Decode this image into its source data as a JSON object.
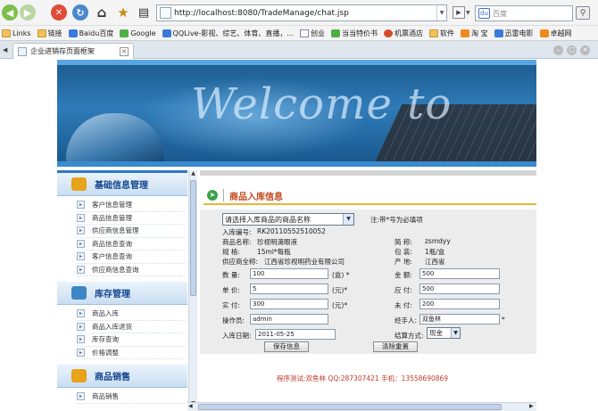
{
  "browser": {
    "address": "http://localhost:8080/TradeManage/chat.jsp",
    "search_placeholder": "百度",
    "search_engine_glyph": "du",
    "bookmarks": [
      {
        "label": "Links",
        "icon": "folder"
      },
      {
        "label": "链接",
        "icon": "folder"
      },
      {
        "label": "Baidu百度",
        "icon": "blue"
      },
      {
        "label": "Google",
        "icon": "green"
      },
      {
        "label": "QQLive-影视、综艺、体育、直播，...",
        "icon": "blue"
      },
      {
        "label": "创业",
        "icon": "page"
      },
      {
        "label": "当当特价书",
        "icon": "green"
      },
      {
        "label": "机票酒店",
        "icon": "red"
      },
      {
        "label": "软件",
        "icon": "folder"
      },
      {
        "label": "淘 宝",
        "icon": "orange"
      },
      {
        "label": "迅雷电影",
        "icon": "blue"
      },
      {
        "label": "卓越网",
        "icon": "orange"
      }
    ],
    "tab_title": "企业进销存页面框架"
  },
  "banner": {
    "text": "Welcome to"
  },
  "sidebar": {
    "sections": [
      {
        "title": "基础信息管理",
        "icon_color": "#e8a21b",
        "items": [
          "客户信息管理",
          "商品信息管理",
          "供应商信息管理",
          "商品信息查询",
          "客户信息查询",
          "供应商信息查询"
        ]
      },
      {
        "title": "库存管理",
        "icon_color": "#3b86c6",
        "items": [
          "商品入库",
          "商品入库退货",
          "库存查询",
          "价格调整"
        ]
      },
      {
        "title": "商品销售",
        "icon_color": "#e8a21b",
        "items": [
          "商品销售"
        ]
      }
    ]
  },
  "panel": {
    "title": "商品入库信息",
    "product_select": "请选择入库商品的商品名称",
    "note": "注:带*号为必填项",
    "stock_no_label": "入库编号:",
    "stock_no_value": "RK20110552510052",
    "product_name_label": "商品名称:",
    "product_name_value": "珍视明滴眼液",
    "abbr_label": "简    称:",
    "abbr_value": "zsmdyy",
    "spec_label": "规    格:",
    "spec_value": "15ml*每瓶",
    "package_label": "包    装:",
    "package_value": "1瓶/盒",
    "supplier_label": "供应商全称:",
    "supplier_value": "江西省珍视明药业有限公司",
    "origin_label": "产    地:",
    "origin_value": "江西省",
    "quantity_label": "数    量:",
    "quantity_value": "100",
    "quantity_unit": "(盒) *",
    "amount_label": "金    额:",
    "amount_value": "500",
    "unit_price_label": "单    价:",
    "unit_price_value": "5",
    "unit_price_unit": "(元)*",
    "payable_label": "应    付:",
    "payable_value": "500",
    "paid_label": "实    付:",
    "paid_value": "300",
    "paid_unit": "(元)*",
    "unpaid_label": "未    付:",
    "unpaid_value": "200",
    "operator_label": "操作员:",
    "operator_value": "admin",
    "handler_label": "经手人:",
    "handler_value": "双鱼林",
    "handler_required": "*",
    "date_label": "入库日期:",
    "date_value": "2011-05-25",
    "settle_label": "结算方式:",
    "settle_value": "现金",
    "save_button": "保存信息",
    "reset_button": "清除重置"
  },
  "footer": {
    "text": "程序测试:双鱼林  QQ:287307421  手机：13558690869"
  }
}
